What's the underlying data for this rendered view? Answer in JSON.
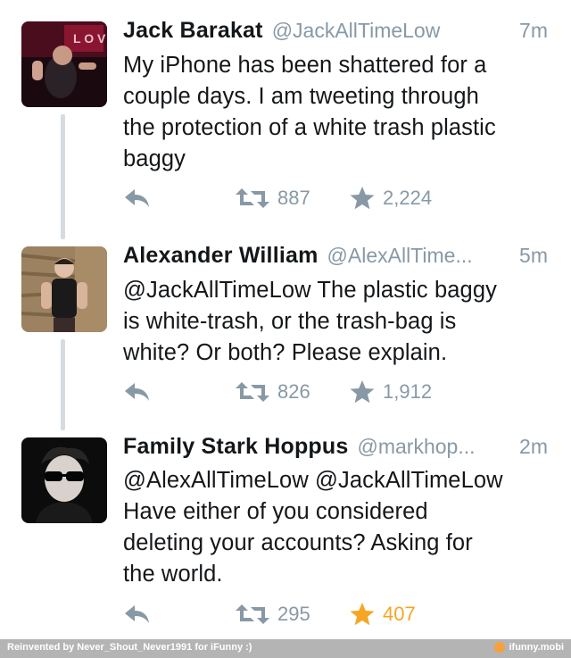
{
  "tweets": [
    {
      "name": "Jack Barakat",
      "handle": "@JackAllTimeLow",
      "time": "7m",
      "lines": [
        "My iPhone has been shattered for a",
        "couple days. I am tweeting through",
        "the protection of a white trash plastic",
        "baggy"
      ],
      "retweets": "887",
      "favorites": "2,224",
      "favorited": false
    },
    {
      "name": "Alexander William",
      "handle": "@AlexAllTime...",
      "time": "5m",
      "lines": [
        "@JackAllTimeLow The plastic baggy",
        "is white-trash, or the trash-bag is",
        "white? Or both? Please explain."
      ],
      "retweets": "826",
      "favorites": "1,912",
      "favorited": false
    },
    {
      "name": "Family Stark Hoppus",
      "handle": "@markhop...",
      "time": "2m",
      "lines": [
        "@AlexAllTimeLow @JackAllTimeLow",
        "Have either of you considered",
        "deleting your accounts? Asking for",
        "the world."
      ],
      "retweets": "295",
      "favorites": "407",
      "favorited": true
    }
  ],
  "icons": {
    "reply": "reply-icon",
    "retweet": "retweet-icon",
    "favorite": "star-icon"
  },
  "colors": {
    "muted": "#8899a6",
    "favorite_active": "#f5a623",
    "thread_line": "#d6dbdf"
  },
  "footer": {
    "credit": "Reinvented by Never_Shout_Never1991 for iFunny :)",
    "site": "ifunny.mobi"
  }
}
